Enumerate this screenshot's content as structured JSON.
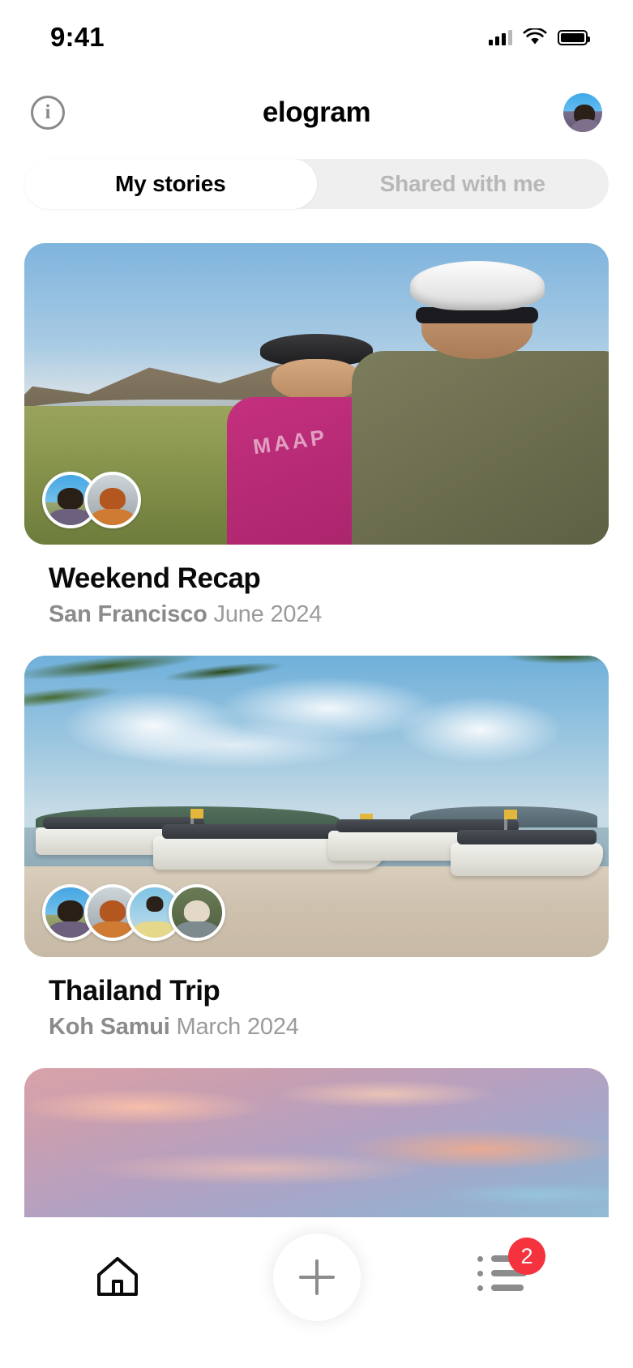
{
  "status_bar": {
    "time": "9:41",
    "cellular_icon": "signal-bars-icon",
    "wifi_icon": "wifi-icon",
    "battery_icon": "battery-full-icon"
  },
  "nav": {
    "info_icon": "info-icon",
    "info_glyph": "i",
    "title": "elogram",
    "profile_avatar": "profile-avatar"
  },
  "segmented_control": {
    "tabs": [
      {
        "label": "My stories",
        "active": true
      },
      {
        "label": "Shared with me",
        "active": false
      }
    ]
  },
  "stories": [
    {
      "title": "Weekend Recap",
      "place": "San Francisco",
      "date": "June 2024",
      "participant_count": 2
    },
    {
      "title": "Thailand Trip",
      "place": "Koh Samui",
      "date": "March 2024",
      "participant_count": 4
    },
    {
      "title": "",
      "place": "",
      "date": "",
      "participant_count": 0
    }
  ],
  "bottom_bar": {
    "home_icon": "home-icon",
    "create_icon": "plus-icon",
    "activity_icon": "list-icon",
    "activity_badge": "2"
  },
  "colors": {
    "badge_red": "#f5333f",
    "segment_track": "#efefef",
    "active_text": "#000000",
    "inactive_text": "#b7b7b7",
    "place_text": "#8b8b8b",
    "date_text": "#9b9b9b"
  }
}
